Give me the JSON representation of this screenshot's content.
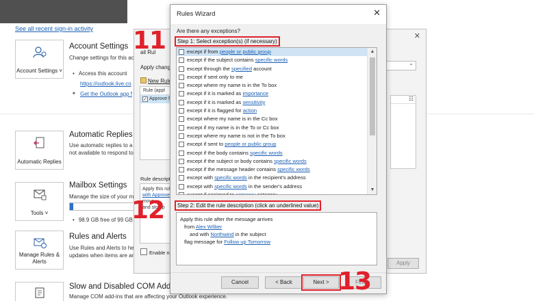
{
  "background": {
    "sign_in_link": "See all recent sign-in activity",
    "sections": {
      "account": {
        "tile_label": "Account Settings ˅",
        "title": "Account Settings",
        "desc": "Change settings for this ac",
        "bullet": "Access this account",
        "link1": "https://outlook.live.co",
        "link2": "Get the Outlook app f"
      },
      "auto_replies": {
        "tile_label": "Automatic Replies",
        "title": "Automatic Replies",
        "desc1": "Use automatic replies to a",
        "desc2": "not available to respond to"
      },
      "mailbox": {
        "tile_label": "Tools ˅",
        "title": "Mailbox Settings",
        "desc": "Manage the size of your m",
        "usage": "98.9 GB free of 99 GB",
        "usage_fraction": 0.05
      },
      "rules": {
        "tile_label": "Manage Rules & Alerts",
        "title": "Rules and Alerts",
        "desc1": "Use Rules and Alerts to he",
        "desc2": "updates when items are an"
      },
      "com_addins": {
        "title": "Slow and Disabled COM Add-ins",
        "desc": "Manage COM add-ins that are affecting your Outlook experience."
      }
    }
  },
  "rules_alerts_dialog": {
    "close": "✕",
    "title_frag": "ail Rul",
    "apply_label": "Apply change",
    "new_rule": "New Rule",
    "list_header": "Rule (appl",
    "list_row": "Approve N",
    "desc_label": "Rule descripti",
    "desc_lines": [
      "Apply this rul",
      "with Approve",
      "move",
      "and stop p"
    ],
    "enable_label": "Enable rule",
    "apply_button": "Apply",
    "right_icon": "☷"
  },
  "wizard": {
    "title": "Rules Wizard",
    "close": "✕",
    "question": "Are there any exceptions?",
    "step1_label": "Step 1: Select exception(s) (if necessary)",
    "conditions": [
      {
        "pre": "except if from ",
        "link": "people or public group",
        "post": ""
      },
      {
        "pre": "except if the subject contains ",
        "link": "specific words",
        "post": ""
      },
      {
        "pre": "except through the ",
        "link": "specified",
        "post": " account"
      },
      {
        "pre": "except if sent only to me",
        "link": "",
        "post": ""
      },
      {
        "pre": "except where my name is in the To box",
        "link": "",
        "post": ""
      },
      {
        "pre": "except if it is marked as ",
        "link": "importance",
        "post": ""
      },
      {
        "pre": "except if it is marked as ",
        "link": "sensitivity",
        "post": ""
      },
      {
        "pre": "except if it is flagged for ",
        "link": "action",
        "post": ""
      },
      {
        "pre": "except where my name is in the Cc box",
        "link": "",
        "post": ""
      },
      {
        "pre": "except if my name is in the To or Cc box",
        "link": "",
        "post": ""
      },
      {
        "pre": "except where my name is not in the To box",
        "link": "",
        "post": ""
      },
      {
        "pre": "except if sent to ",
        "link": "people or public group",
        "post": ""
      },
      {
        "pre": "except if the body contains ",
        "link": "specific words",
        "post": ""
      },
      {
        "pre": "except if the subject or body contains ",
        "link": "specific words",
        "post": ""
      },
      {
        "pre": "except if the message header contains ",
        "link": "specific words",
        "post": ""
      },
      {
        "pre": "except with ",
        "link": "specific words",
        "post": " in the recipient's address"
      },
      {
        "pre": "except with ",
        "link": "specific words",
        "post": " in the sender's address"
      },
      {
        "pre": "except if assigned to ",
        "link": "category",
        "post": " category"
      }
    ],
    "step2_label": "Step 2: Edit the rule description (click an underlined value)",
    "description": {
      "line1": "Apply this rule after the message arrives",
      "line2_pre": "from ",
      "line2_link": "Alex Wilber",
      "line3_pre": "and with ",
      "line3_link": "Northwind",
      "line3_post": " in the subject",
      "line4_pre": "flag message for ",
      "line4_link": "Follow up Tomorrow"
    },
    "buttons": {
      "cancel": "Cancel",
      "back": "< Back",
      "next": "Next >",
      "finish": "Finish"
    }
  },
  "annotations": {
    "step1_number": "11",
    "step2_number": "12",
    "step3_number": "13"
  },
  "colors": {
    "accent_red": "#e0202a",
    "link_blue": "#1a5fb4",
    "selection": "#cfe3f5"
  }
}
